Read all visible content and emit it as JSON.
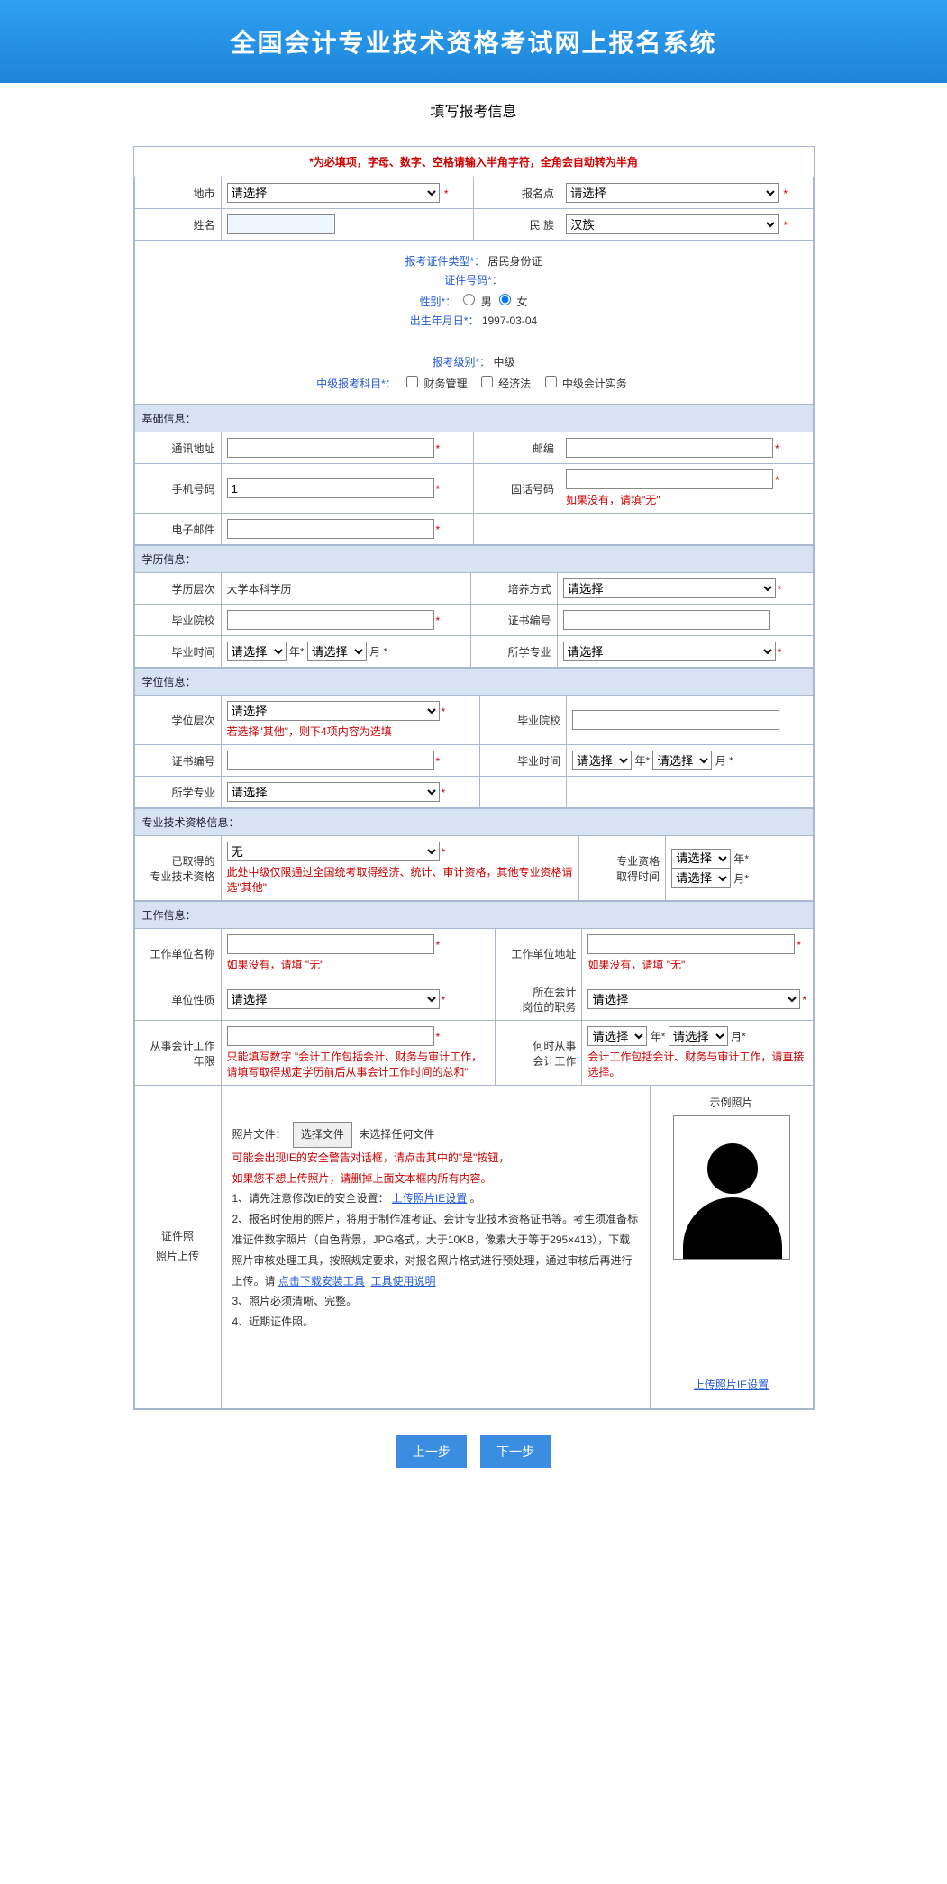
{
  "header": {
    "title": "全国会计专业技术资格考试网上报名系统"
  },
  "page": {
    "title": "填写报考信息"
  },
  "top_warning": "*为必填项，字母、数字、空格请输入半角字符，全角会自动转为半角",
  "row1": {
    "city_label": "地市",
    "city_value": "请选择",
    "site_label": "报名点",
    "site_value": "请选择"
  },
  "row2": {
    "name_label": "姓名",
    "name_value": "",
    "nation_label": "民 族",
    "nation_value": "汉族"
  },
  "id_block": {
    "type_label": "报考证件类型*：",
    "type_value": "居民身份证",
    "no_label": "证件号码*：",
    "no_value": "",
    "gender_label": "性别*：",
    "gender_male": "男",
    "gender_female": "女",
    "birth_label": "出生年月日*：",
    "birth_value": "1997-03-04"
  },
  "level_block": {
    "level_label": "报考级别*：",
    "level_value": "中级",
    "subjects_label": "中级报考科目*：",
    "s1": "财务管理",
    "s2": "经济法",
    "s3": "中级会计实务"
  },
  "sec_basic": "基础信息：",
  "basic": {
    "addr_label": "通讯地址",
    "post_label": "邮编",
    "mobile_label": "手机号码",
    "mobile_value": "1",
    "tel_label": "固话号码",
    "tel_hint": "如果没有，请填\"无\"",
    "email_label": "电子邮件",
    "email_value": ""
  },
  "sec_edu": "学历信息：",
  "edu": {
    "level_label": "学历层次",
    "level_value": "大学本科学历",
    "train_label": "培养方式",
    "train_value": "请选择",
    "school_label": "毕业院校",
    "certno_label": "证书编号",
    "gradtime_label": "毕业时间",
    "year_ph": "请选择",
    "month_ph": "请选择",
    "year_sfx": "年*",
    "month_sfx": "月 *",
    "major_label": "所学专业",
    "major_value": "请选择"
  },
  "sec_deg": "学位信息：",
  "deg": {
    "level_label": "学位层次",
    "level_value": "请选择",
    "level_hint": "若选择\"其他\"，则下4项内容为选填",
    "school_label": "毕业院校",
    "certno_label": "证书编号",
    "gradtime_label": "毕业时间",
    "year_ph": "请选择",
    "month_ph": "请选择",
    "year_sfx": "年*",
    "month_sfx": "月 *",
    "major_label": "所学专业",
    "major_value": "请选择"
  },
  "sec_prof": "专业技术资格信息：",
  "prof": {
    "got_label1": "已取得的",
    "got_label2": "专业技术资格",
    "got_value": "无",
    "got_hint": "此处中级仅限通过全国统考取得经济、统计、审计资格，其他专业资格请选\"其他\"",
    "time_label1": "专业资格",
    "time_label2": "取得时间",
    "year_ph": "请选择",
    "month_ph": "请选择",
    "year_sfx": "年*",
    "month_sfx": "月*"
  },
  "sec_work": "工作信息：",
  "work": {
    "unit_label": "工作单位名称",
    "unit_hint": "如果没有，请填 \"无\"",
    "unitaddr_label": "工作单位地址",
    "unitaddr_hint": "如果没有，请填 \"无\"",
    "unittype_label": "单位性质",
    "unittype_value": "请选择",
    "duty_label1": "所在会计",
    "duty_label2": "岗位的职务",
    "duty_value": "请选择",
    "years_label": "从事会计工作年限",
    "years_hint": "只能填写数字 \"会计工作包括会计、财务与审计工作，请填写取得规定学历前后从事会计工作时间的总和\"",
    "start_label1": "何时从事",
    "start_label2": "会计工作",
    "start_year_ph": "请选择",
    "start_month_ph": "请选择",
    "start_year_sfx": "年*",
    "start_month_sfx": "月*",
    "start_hint": "会计工作包括会计、财务与审计工作，请直接选择。"
  },
  "photo": {
    "side_label1": "证件照",
    "side_label2": "照片上传",
    "file_label": "照片文件：",
    "choose_btn": "选择文件",
    "no_file": "未选择任何文件",
    "warn1": "可能会出现IE的安全警告对话框，请点击其中的\"是\"按钮，",
    "warn2": "如果您不想上传照片，请删掉上面文本框内所有内容。",
    "l1a": "1、请先注意修改IE的安全设置：",
    "l1b": "上传照片IE设置",
    "l1c": "。",
    "l2": "2、报名时使用的照片，将用于制作准考证、会计专业技术资格证书等。考生须准备标准证件数字照片（白色背景，JPG格式，大于10KB，像素大于等于295×413），下载照片审核处理工具，按照规定要求，对报名照片格式进行预处理，通过审核后再进行上传。请",
    "l2a": "点击下载安装工具",
    "l2b": "工具使用说明",
    "l3": "3、照片必须清晰、完整。",
    "l4": "4、近期证件照。",
    "sample_title": "示例照片",
    "bottom_link": "上传照片IE设置"
  },
  "buttons": {
    "prev": "上一步",
    "next": "下一步"
  }
}
